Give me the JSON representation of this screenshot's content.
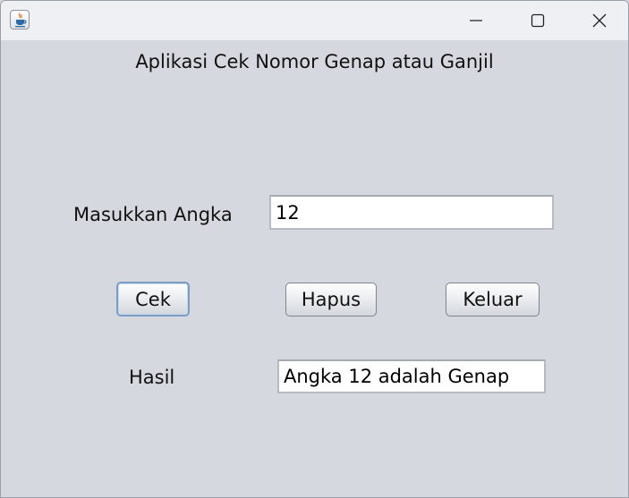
{
  "window": {
    "title": "",
    "icon": "java-cup-icon",
    "controls": [
      "minimize-icon",
      "maximize-icon",
      "close-icon"
    ]
  },
  "form": {
    "heading": "Aplikasi Cek Nomor Genap atau Ganjil",
    "input_label": "Masukkan Angka",
    "input_value": "12",
    "result_label": "Hasil",
    "result_value": "Angka 12 adalah Genap"
  },
  "buttons": {
    "check": "Cek",
    "clear": "Hapus",
    "exit": "Keluar"
  }
}
